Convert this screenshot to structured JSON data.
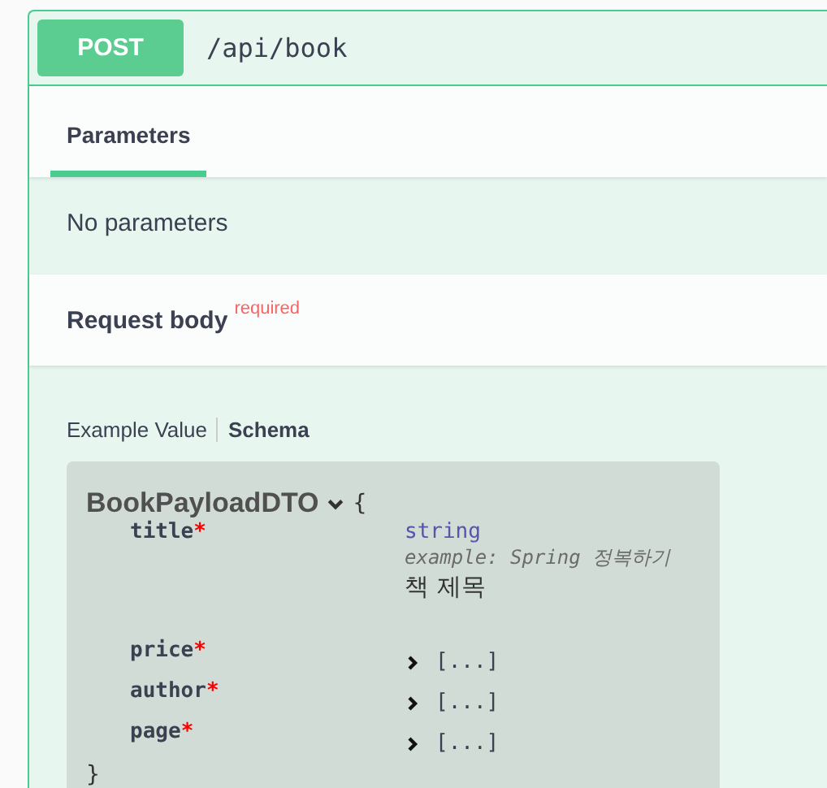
{
  "operation": {
    "method": "POST",
    "path": "/api/book"
  },
  "tabs": [
    {
      "label": "Parameters",
      "selected": true
    }
  ],
  "parameters": {
    "empty_text": "No parameters"
  },
  "request_body": {
    "title": "Request body",
    "required": true,
    "required_label": "required"
  },
  "body_tabs": [
    {
      "label": "Example Value",
      "selected": false
    },
    {
      "label": "Schema",
      "selected": true
    }
  ],
  "model": {
    "name": "BookPayloadDTO",
    "expanded": true,
    "open_brace": "{",
    "close_brace": "}",
    "properties": [
      {
        "name": "title",
        "mark": "*",
        "kind": "value",
        "type": "string",
        "example": "example: Spring 정복하기",
        "description": "책 제목"
      },
      {
        "name": "price",
        "mark": "*",
        "kind": "collapsed",
        "expanded": false,
        "summary": "[...]"
      },
      {
        "name": "author",
        "mark": "*",
        "kind": "collapsed",
        "expanded": false,
        "summary": "[...]"
      },
      {
        "name": "page",
        "mark": "*",
        "kind": "collapsed",
        "expanded": false,
        "summary": "[...]"
      }
    ]
  }
}
